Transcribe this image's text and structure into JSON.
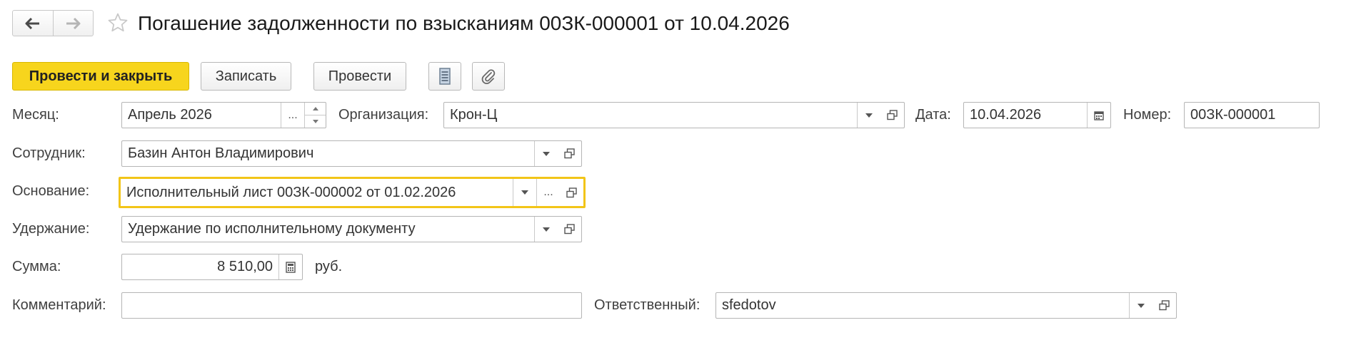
{
  "nav": {
    "back_icon": "arrow-left-icon",
    "forward_icon": "arrow-right-icon"
  },
  "header": {
    "title": "Погашение задолженности по взысканиям 00ЗК-000001 от 10.04.2026",
    "favorite_icon": "star-icon"
  },
  "toolbar": {
    "post_close_label": "Провести и закрыть",
    "save_label": "Записать",
    "post_label": "Провести",
    "report_icon": "document-list-icon",
    "attach_icon": "paperclip-icon"
  },
  "form": {
    "month": {
      "label": "Месяц:",
      "value": "Апрель 2026",
      "select_glyph": "..."
    },
    "organization": {
      "label": "Организация:",
      "value": "Крон-Ц"
    },
    "date": {
      "label": "Дата:",
      "value": "10.04.2026"
    },
    "number": {
      "label": "Номер:",
      "value": "00ЗК-000001"
    },
    "employee": {
      "label": "Сотрудник:",
      "value": "Базин Антон Владимирович"
    },
    "basis": {
      "label": "Основание:",
      "value": "Исполнительный лист 00ЗК-000002 от 01.02.2026",
      "select_glyph": "..."
    },
    "deduction": {
      "label": "Удержание:",
      "value": "Удержание по исполнительному документу"
    },
    "amount": {
      "label": "Сумма:",
      "value": "8 510,00",
      "currency": "руб."
    },
    "comment": {
      "label": "Комментарий:",
      "value": ""
    },
    "responsible": {
      "label": "Ответственный:",
      "value": "sfedotov"
    }
  },
  "colors": {
    "accent": "#f7d51d",
    "focus_border": "#f2c518"
  }
}
